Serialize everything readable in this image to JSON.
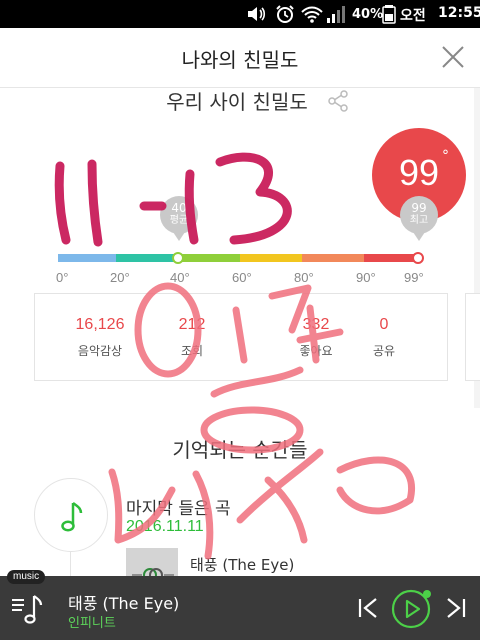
{
  "status_bar": {
    "battery": "40%",
    "ampm": "오전",
    "time": "12:55"
  },
  "header": {
    "title": "나와의 친밀도"
  },
  "intimacy": {
    "section_title": "우리 사이 친밀도",
    "score": "99",
    "score_unit": "°",
    "my_marker": {
      "value": "40",
      "label": "평균"
    },
    "top_marker": {
      "value": "99",
      "label": "최고"
    },
    "ticks": [
      "0°",
      "20°",
      "40°",
      "60°",
      "80°",
      "90°",
      "99°"
    ],
    "gauge_colors": [
      "#7db8ea",
      "#2ec3a5",
      "#8fcf3a",
      "#f2c61f",
      "#f2885a",
      "#e8484b"
    ]
  },
  "stats": [
    {
      "value": "16,126",
      "label": "음악감상"
    },
    {
      "value": "212",
      "label": "조회"
    },
    {
      "value": "332",
      "label": "좋아요"
    },
    {
      "value": "0",
      "label": "공유"
    }
  ],
  "moments": {
    "title": "기억되는 순간들",
    "last_song_label": "마지막 들은 곡",
    "last_song_date": "2016.11.11",
    "song_title": "태풍 (The Eye)"
  },
  "player": {
    "badge": "music",
    "title": "태풍 (The Eye)",
    "artist": "인피니트"
  },
  "colors": {
    "accent_red": "#e8484b",
    "accent_green": "#2ebd3a",
    "player_bg": "#3a3a3a"
  }
}
